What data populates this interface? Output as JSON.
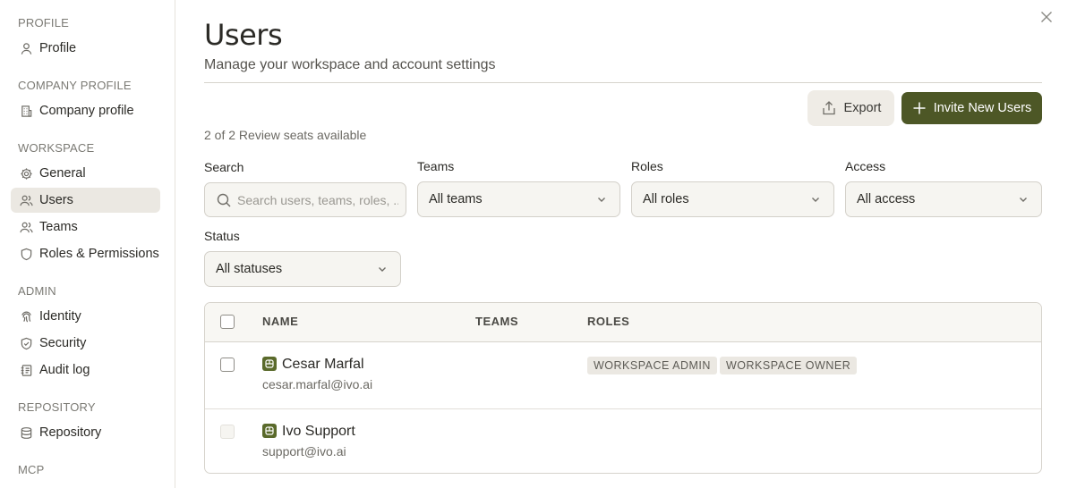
{
  "sidebar": {
    "sections": [
      {
        "title": "PROFILE",
        "items": [
          {
            "label": "Profile",
            "icon": "person-icon"
          }
        ]
      },
      {
        "title": "COMPANY PROFILE",
        "items": [
          {
            "label": "Company profile",
            "icon": "building-icon"
          }
        ]
      },
      {
        "title": "WORKSPACE",
        "items": [
          {
            "label": "General",
            "icon": "gear-icon"
          },
          {
            "label": "Users",
            "icon": "users-icon",
            "active": true
          },
          {
            "label": "Teams",
            "icon": "team-icon"
          },
          {
            "label": "Roles & Permissions",
            "icon": "shield-icon"
          }
        ]
      },
      {
        "title": "ADMIN",
        "items": [
          {
            "label": "Identity",
            "icon": "fingerprint-icon"
          },
          {
            "label": "Security",
            "icon": "shield-check-icon"
          },
          {
            "label": "Audit log",
            "icon": "audit-log-icon"
          }
        ]
      },
      {
        "title": "REPOSITORY",
        "items": [
          {
            "label": "Repository",
            "icon": "database-icon"
          }
        ]
      },
      {
        "title": "MCP",
        "items": []
      }
    ]
  },
  "header": {
    "title": "Users",
    "subtitle": "Manage your workspace and account settings"
  },
  "actions": {
    "export_label": "Export",
    "invite_label": "Invite New Users"
  },
  "seats_text": "2 of 2 Review seats available",
  "filters": {
    "search": {
      "label": "Search",
      "placeholder": "Search users, teams, roles, ..."
    },
    "teams": {
      "label": "Teams",
      "value": "All teams"
    },
    "roles": {
      "label": "Roles",
      "value": "All roles"
    },
    "access": {
      "label": "Access",
      "value": "All access"
    },
    "status": {
      "label": "Status",
      "value": "All statuses"
    }
  },
  "table": {
    "columns": [
      "NAME",
      "TEAMS",
      "ROLES"
    ],
    "rows": [
      {
        "name": "Cesar Marfal",
        "email": "cesar.marfal@ivo.ai",
        "roles": [
          "WORKSPACE ADMIN",
          "WORKSPACE OWNER"
        ]
      },
      {
        "name": "Ivo Support",
        "email": "support@ivo.ai",
        "roles": []
      }
    ]
  },
  "colors": {
    "accent": "#4d5726",
    "active_nav": "#ebe8e2",
    "user_logo": "#5a6a2b"
  }
}
